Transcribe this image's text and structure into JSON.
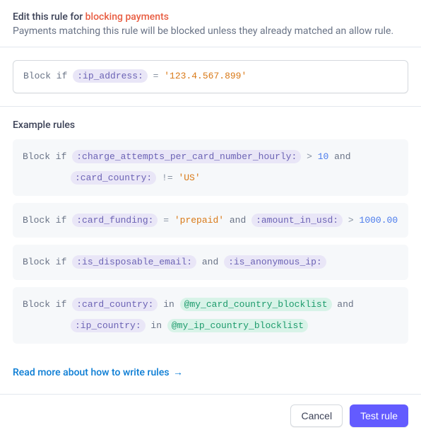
{
  "header": {
    "title_prefix": "Edit this rule for ",
    "title_highlight": "blocking payments",
    "description": "Payments matching this rule will be blocked unless they already matched an allow rule."
  },
  "rule_editor": {
    "prefix": "Block if ",
    "field": ":ip_address:",
    "operator": " = ",
    "value": "'123.4.567.899'"
  },
  "examples": {
    "heading": "Example rules",
    "rules": [
      {
        "tokens": [
          {
            "t": "kw",
            "v": "Block if "
          },
          {
            "t": "field",
            "v": ":charge_attempts_per_card_number_hourly:"
          },
          {
            "t": "op",
            "v": " > "
          },
          {
            "t": "num",
            "v": "10"
          },
          {
            "t": "kw",
            "v": " and"
          },
          {
            "t": "br"
          },
          {
            "t": "indent"
          },
          {
            "t": "field",
            "v": ":card_country:"
          },
          {
            "t": "op",
            "v": " != "
          },
          {
            "t": "str",
            "v": "'US'"
          }
        ]
      },
      {
        "tokens": [
          {
            "t": "kw",
            "v": "Block if "
          },
          {
            "t": "field",
            "v": ":card_funding:"
          },
          {
            "t": "op",
            "v": " = "
          },
          {
            "t": "str",
            "v": "'prepaid'"
          },
          {
            "t": "kw",
            "v": " and "
          },
          {
            "t": "field",
            "v": ":amount_in_usd:"
          },
          {
            "t": "op",
            "v": " > "
          },
          {
            "t": "num",
            "v": "1000.00"
          }
        ]
      },
      {
        "tokens": [
          {
            "t": "kw",
            "v": "Block if "
          },
          {
            "t": "field",
            "v": ":is_disposable_email:"
          },
          {
            "t": "kw",
            "v": " and "
          },
          {
            "t": "field",
            "v": ":is_anonymous_ip:"
          }
        ]
      },
      {
        "tokens": [
          {
            "t": "kw",
            "v": "Block if "
          },
          {
            "t": "field",
            "v": ":card_country:"
          },
          {
            "t": "kw",
            "v": " in "
          },
          {
            "t": "list",
            "v": "@my_card_country_blocklist"
          },
          {
            "t": "kw",
            "v": " and"
          },
          {
            "t": "br"
          },
          {
            "t": "indent"
          },
          {
            "t": "field",
            "v": ":ip_country:"
          },
          {
            "t": "kw",
            "v": " in "
          },
          {
            "t": "list",
            "v": "@my_ip_country_blocklist"
          }
        ]
      }
    ]
  },
  "help_link": {
    "text": "Read more about how to write rules",
    "arrow": "→"
  },
  "footer": {
    "cancel": "Cancel",
    "test": "Test rule"
  },
  "colors": {
    "accent": "#635bff",
    "danger": "#e85d42",
    "link": "#0a7cd4"
  }
}
